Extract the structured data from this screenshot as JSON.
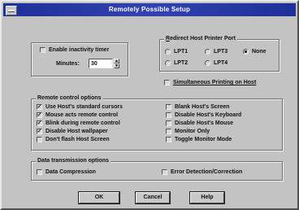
{
  "window": {
    "title": "Remotely Possible Setup"
  },
  "inactivity": {
    "enable_label": "Enable inactivity timer",
    "minutes_label": "Minutes:",
    "minutes_value": "30"
  },
  "printer": {
    "title": "Redirect Host Printer Port",
    "options": [
      "LPT1",
      "LPT3",
      "None",
      "LPT2",
      "LPT4"
    ],
    "selected": "None",
    "simultaneous_label": "Simultaneous Printing on Host"
  },
  "remote": {
    "title": "Remote control options",
    "left": [
      {
        "label": "Use Host's standard cursors",
        "checked": true
      },
      {
        "label": "Mouse acts remote control",
        "checked": true
      },
      {
        "label": "Blink during remote control",
        "checked": true
      },
      {
        "label": "Disable Host wallpaper",
        "checked": true
      },
      {
        "label": "Don't flash Host Screen",
        "checked": false
      }
    ],
    "right": [
      {
        "label": "Blank Host's Screen",
        "checked": false
      },
      {
        "label": "Disable Host's Keyboard",
        "checked": false
      },
      {
        "label": "Disable Host's Mouse",
        "checked": false
      },
      {
        "label": "Monitor Only",
        "checked": false
      },
      {
        "label": "Toggle Monitor Mode",
        "checked": false
      }
    ]
  },
  "transmission": {
    "title": "Data transmission options",
    "compression_label": "Data Compression",
    "error_label": "Error Detection/Correction"
  },
  "buttons": {
    "ok": "OK",
    "cancel": "Cancel",
    "help": "Help"
  }
}
